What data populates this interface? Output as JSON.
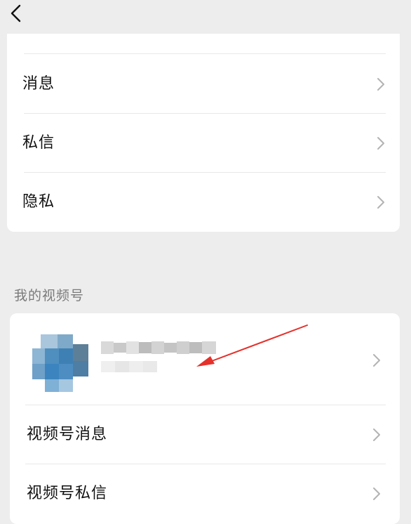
{
  "top_menu": {
    "items": [
      {
        "label": "消息"
      },
      {
        "label": "私信"
      },
      {
        "label": "隐私"
      }
    ]
  },
  "channels_section": {
    "title": "我的视频号",
    "items": [
      {
        "label": "视频号消息"
      },
      {
        "label": "视频号私信"
      }
    ]
  },
  "colors": {
    "background": "#ededed",
    "card": "#ffffff",
    "annotation_arrow": "#e5312b",
    "avatar_blue": "#4f8fc0"
  },
  "icons": [
    "back-icon",
    "chevron-right-icon",
    "avatar",
    "annotation-arrow"
  ]
}
